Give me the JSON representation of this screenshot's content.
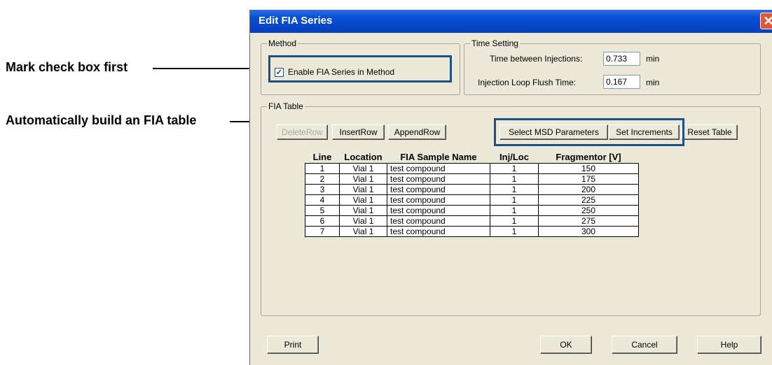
{
  "callouts": {
    "mark_checkbox": "Mark check box first",
    "build_table": "Automatically build an FIA table"
  },
  "window": {
    "title": "Edit FIA Series",
    "close_glyph": "✕"
  },
  "method": {
    "group_label": "Method",
    "enable_label": "Enable FIA Series in Method",
    "enable_checked": true,
    "check_glyph": "✓"
  },
  "time_setting": {
    "group_label": "Time Setting",
    "between_label": "Time between Injections:",
    "between_value": "0.733",
    "between_unit": "min",
    "flush_label": "Injection Loop Flush Time:",
    "flush_value": "0.167",
    "flush_unit": "min"
  },
  "fia_table": {
    "group_label": "FIA Table",
    "buttons": {
      "delete_row": "DeleteRow",
      "insert_row": "InsertRow",
      "append_row": "AppendRow",
      "select_msd": "Select MSD Parameters",
      "set_increments": "Set Increments",
      "reset_table": "Reset Table"
    },
    "columns": [
      "Line",
      "Location",
      "FIA Sample Name",
      "Inj/Loc",
      "Fragmentor [V]"
    ],
    "rows": [
      [
        "1",
        "Vial 1",
        "test compound",
        "1",
        "150"
      ],
      [
        "2",
        "Vial 1",
        "test compound",
        "1",
        "175"
      ],
      [
        "3",
        "Vial 1",
        "test compound",
        "1",
        "200"
      ],
      [
        "4",
        "Vial 1",
        "test compound",
        "1",
        "225"
      ],
      [
        "5",
        "Vial 1",
        "test compound",
        "1",
        "250"
      ],
      [
        "6",
        "Vial 1",
        "test compound",
        "1",
        "275"
      ],
      [
        "7",
        "Vial 1",
        "test compound",
        "1",
        "300"
      ]
    ]
  },
  "footer": {
    "print": "Print",
    "ok": "OK",
    "cancel": "Cancel",
    "help": "Help"
  }
}
